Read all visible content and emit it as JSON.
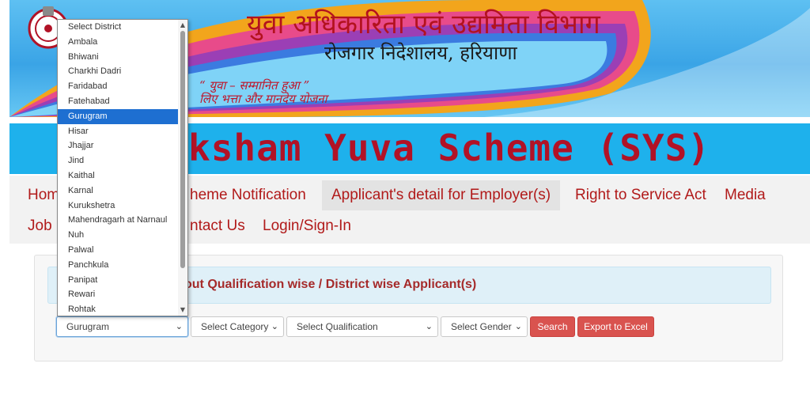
{
  "banner": {
    "hindi_title": "युवा अधिकारिता एवं उद्यमिता विभाग",
    "hindi_subtitle": "रोजगार निदेशालय, हरियाणा",
    "tagline_line1": "“ युवा – सम्मानित हुआ ”",
    "tagline_line2": "लिए भत्ता और मानदेय योजना"
  },
  "scheme_title": "ksham Yuva Scheme (SYS)",
  "nav": {
    "row1": [
      "Hom",
      "heme Notification",
      "Applicant's detail for Employer(s)",
      "Right to Service Act",
      "Media"
    ],
    "row2": [
      "Job",
      "ntact Us",
      "Login/Sign-In"
    ],
    "active": "Applicant's detail for Employer(s)"
  },
  "panel": {
    "heading": "out Qualification wise / District wise Applicant(s)"
  },
  "filters": {
    "district_value": "Gurugram",
    "category_value": "Select Category",
    "qualification_value": "Select Qualification",
    "gender_value": "Select Gender",
    "search_label": "Search",
    "export_label": "Export to Excel"
  },
  "district_dropdown": {
    "options": [
      "Select District",
      "Ambala",
      "Bhiwani",
      "Charkhi Dadri",
      "Faridabad",
      "Fatehabad",
      "Gurugram",
      "Hisar",
      "Jhajjar",
      "Jind",
      "Kaithal",
      "Karnal",
      "Kurukshetra",
      "Mahendragarh at Narnaul",
      "Nuh",
      "Palwal",
      "Panchkula",
      "Panipat",
      "Rewari",
      "Rohtak"
    ],
    "selected": "Gurugram"
  },
  "icons": {
    "emblem": "haryana-emblem-icon",
    "chevron": "chevron-down-icon"
  },
  "colors": {
    "banner_blue": "#3aa4e6",
    "title_bar": "#1eb1ec",
    "accent_red": "#b11226",
    "button_red": "#d9534f",
    "selection_blue": "#1e6fd1",
    "heading_bg": "#dff0f8"
  }
}
